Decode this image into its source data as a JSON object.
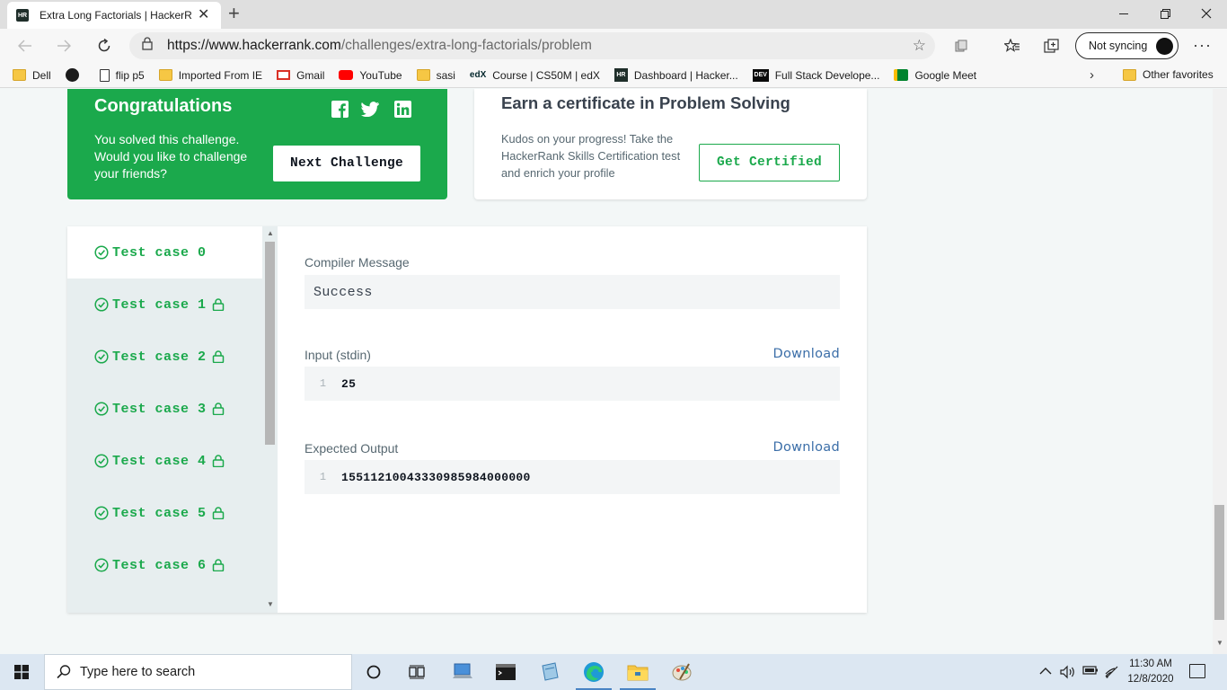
{
  "browser": {
    "tab_title": "Extra Long Factorials | HackerRank",
    "tab_favicon": "HR",
    "url_host": "https://www.hackerrank.com",
    "url_path": "/challenges/extra-long-factorials/problem",
    "sync_label": "Not syncing",
    "new_tab_glyph": "+",
    "close_glyph": "✕"
  },
  "bookmarks": {
    "items": [
      {
        "label": "Dell",
        "icon": "folder-icon"
      },
      {
        "label": "",
        "icon": "github-icon"
      },
      {
        "label": "flip p5",
        "icon": "document-icon"
      },
      {
        "label": "Imported From IE",
        "icon": "folder-icon"
      },
      {
        "label": "Gmail",
        "icon": "gmail-icon"
      },
      {
        "label": "YouTube",
        "icon": "youtube-icon"
      },
      {
        "label": "sasi",
        "icon": "folder-icon"
      },
      {
        "label": "Course | CS50M | edX",
        "icon": "edx-icon"
      },
      {
        "label": "Dashboard | Hacker...",
        "icon": "hackerrank-icon"
      },
      {
        "label": "Full Stack Develope...",
        "icon": "dev-icon"
      },
      {
        "label": "Google Meet",
        "icon": "google-meet-icon"
      }
    ],
    "other_label": "Other favorites",
    "edx_glyph": "edX",
    "hr_glyph": "HR",
    "dev_glyph": "DEV"
  },
  "congrats": {
    "title": "Congratulations",
    "message": "You solved this challenge. Would you like to challenge your friends?",
    "next_button": "Next Challenge"
  },
  "certificate": {
    "title": "Earn a certificate in Problem Solving",
    "message": "Kudos on your progress! Take the HackerRank Skills Certification test and enrich your profile",
    "button": "Get Certified"
  },
  "test_cases": [
    {
      "label": "Test case 0",
      "locked": false,
      "passed": true
    },
    {
      "label": "Test case 1",
      "locked": true,
      "passed": true
    },
    {
      "label": "Test case 2",
      "locked": true,
      "passed": true
    },
    {
      "label": "Test case 3",
      "locked": true,
      "passed": true
    },
    {
      "label": "Test case 4",
      "locked": true,
      "passed": true
    },
    {
      "label": "Test case 5",
      "locked": true,
      "passed": true
    },
    {
      "label": "Test case 6",
      "locked": true,
      "passed": true
    }
  ],
  "result": {
    "compiler_label": "Compiler Message",
    "compiler_message": "Success",
    "input_label": "Input (stdin)",
    "input_download": "Download",
    "input_line_no": "1",
    "input_value": "25",
    "output_label": "Expected Output",
    "output_download": "Download",
    "output_line_no": "1",
    "output_value": "15511210043330985984000000"
  },
  "taskbar": {
    "search_placeholder": "Type here to search",
    "time": "11:30 AM",
    "date": "12/8/2020"
  },
  "colors": {
    "accent_green": "#1ba94c",
    "link_blue": "#3b6ea8"
  }
}
